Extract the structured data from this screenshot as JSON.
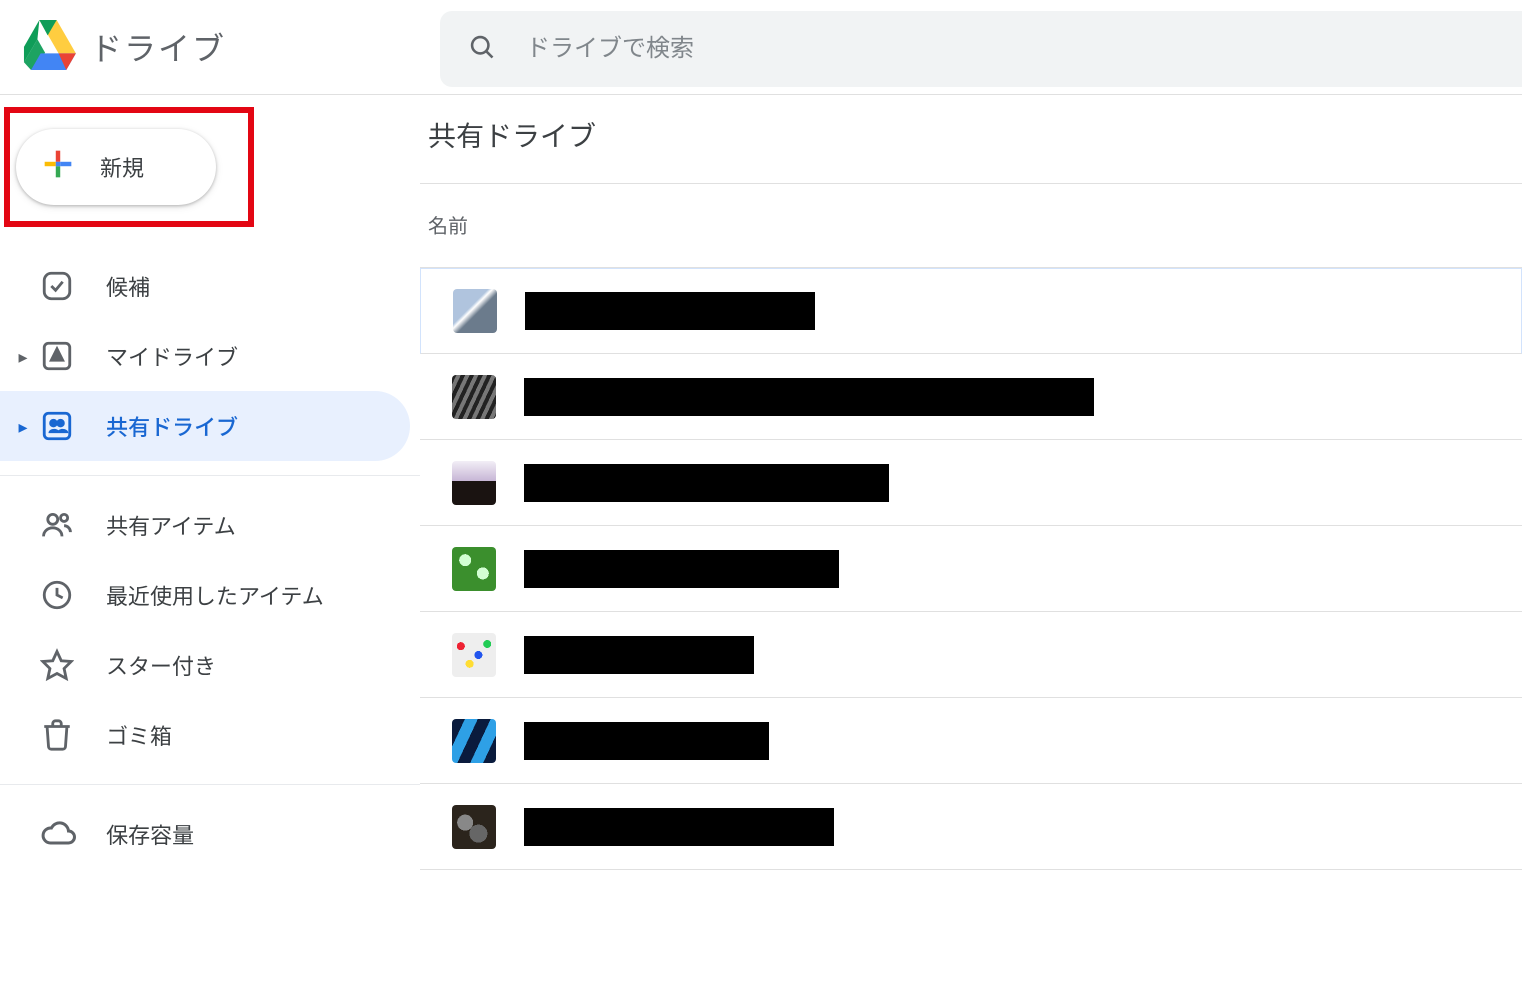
{
  "app": {
    "title": "ドライブ"
  },
  "search": {
    "placeholder": "ドライブで検索"
  },
  "new_button": {
    "label": "新規"
  },
  "sidebar": {
    "items": [
      {
        "label": "候補"
      },
      {
        "label": "マイドライブ"
      },
      {
        "label": "共有ドライブ"
      },
      {
        "label": "共有アイテム"
      },
      {
        "label": "最近使用したアイテム"
      },
      {
        "label": "スター付き"
      },
      {
        "label": "ゴミ箱"
      },
      {
        "label": "保存容量"
      }
    ]
  },
  "main": {
    "title": "共有ドライブ",
    "column_header": "名前",
    "rows": [
      {
        "thumb": "t0",
        "redact_w": 290
      },
      {
        "thumb": "t1",
        "redact_w": 570
      },
      {
        "thumb": "t2",
        "redact_w": 365
      },
      {
        "thumb": "t3",
        "redact_w": 315
      },
      {
        "thumb": "t4",
        "redact_w": 230
      },
      {
        "thumb": "t5",
        "redact_w": 245
      },
      {
        "thumb": "t6",
        "redact_w": 310
      }
    ]
  }
}
